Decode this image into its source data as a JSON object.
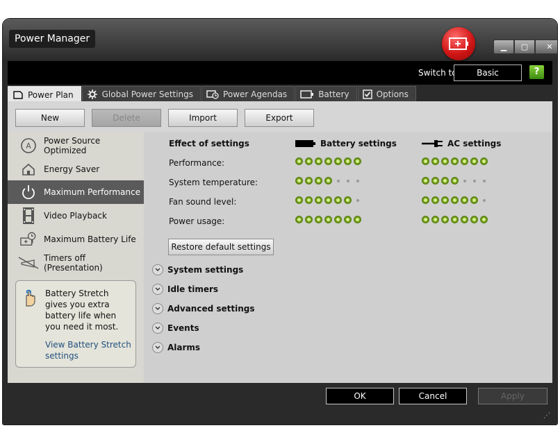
{
  "window": {
    "title": "Power Manager"
  },
  "toolbar": {
    "switch_label": "Switch to:",
    "switch_button": "Basic",
    "help": "?"
  },
  "tabs": [
    {
      "label": "Power Plan",
      "icon": "plan-icon",
      "active": true
    },
    {
      "label": "Global Power Settings",
      "icon": "gear-icon"
    },
    {
      "label": "Power Agendas",
      "icon": "agenda-icon"
    },
    {
      "label": "Battery",
      "icon": "battery-icon"
    },
    {
      "label": "Options",
      "icon": "checkbox-icon"
    }
  ],
  "actions": {
    "new": "New",
    "delete": "Delete",
    "import": "Import",
    "export": "Export"
  },
  "plans": [
    {
      "label": "Power Source Optimized",
      "icon": "auto-icon"
    },
    {
      "label": "Energy Saver",
      "icon": "house-icon"
    },
    {
      "label": "Maximum Performance",
      "icon": "power-icon",
      "active": true
    },
    {
      "label": "Video Playback",
      "icon": "film-icon"
    },
    {
      "label": "Maximum Battery Life",
      "icon": "battery-clock-icon"
    },
    {
      "label": "Timers off (Presentation)",
      "icon": "timer-off-icon"
    }
  ],
  "tip": {
    "text": "Battery Stretch gives you extra battery life when you need it most.",
    "link": "View Battery Stretch settings"
  },
  "effects": {
    "header": "Effect of settings",
    "battery_header": "Battery settings",
    "ac_header": "AC settings",
    "rows": [
      {
        "label": "Performance:",
        "battery": 7,
        "ac": 7
      },
      {
        "label": "System temperature:",
        "battery": 4,
        "ac": 4
      },
      {
        "label": "Fan sound level:",
        "battery": 6,
        "ac": 6
      },
      {
        "label": "Power usage:",
        "battery": 7,
        "ac": 7
      }
    ],
    "max": 7,
    "restore": "Restore default settings"
  },
  "sections": [
    "System settings",
    "Idle timers",
    "Advanced settings",
    "Events",
    "Alarms"
  ],
  "footer": {
    "ok": "OK",
    "cancel": "Cancel",
    "apply": "Apply"
  },
  "colors": {
    "badge": "#d21616",
    "dot": "#7aa41c",
    "active_plan": "#5a5a5a"
  }
}
